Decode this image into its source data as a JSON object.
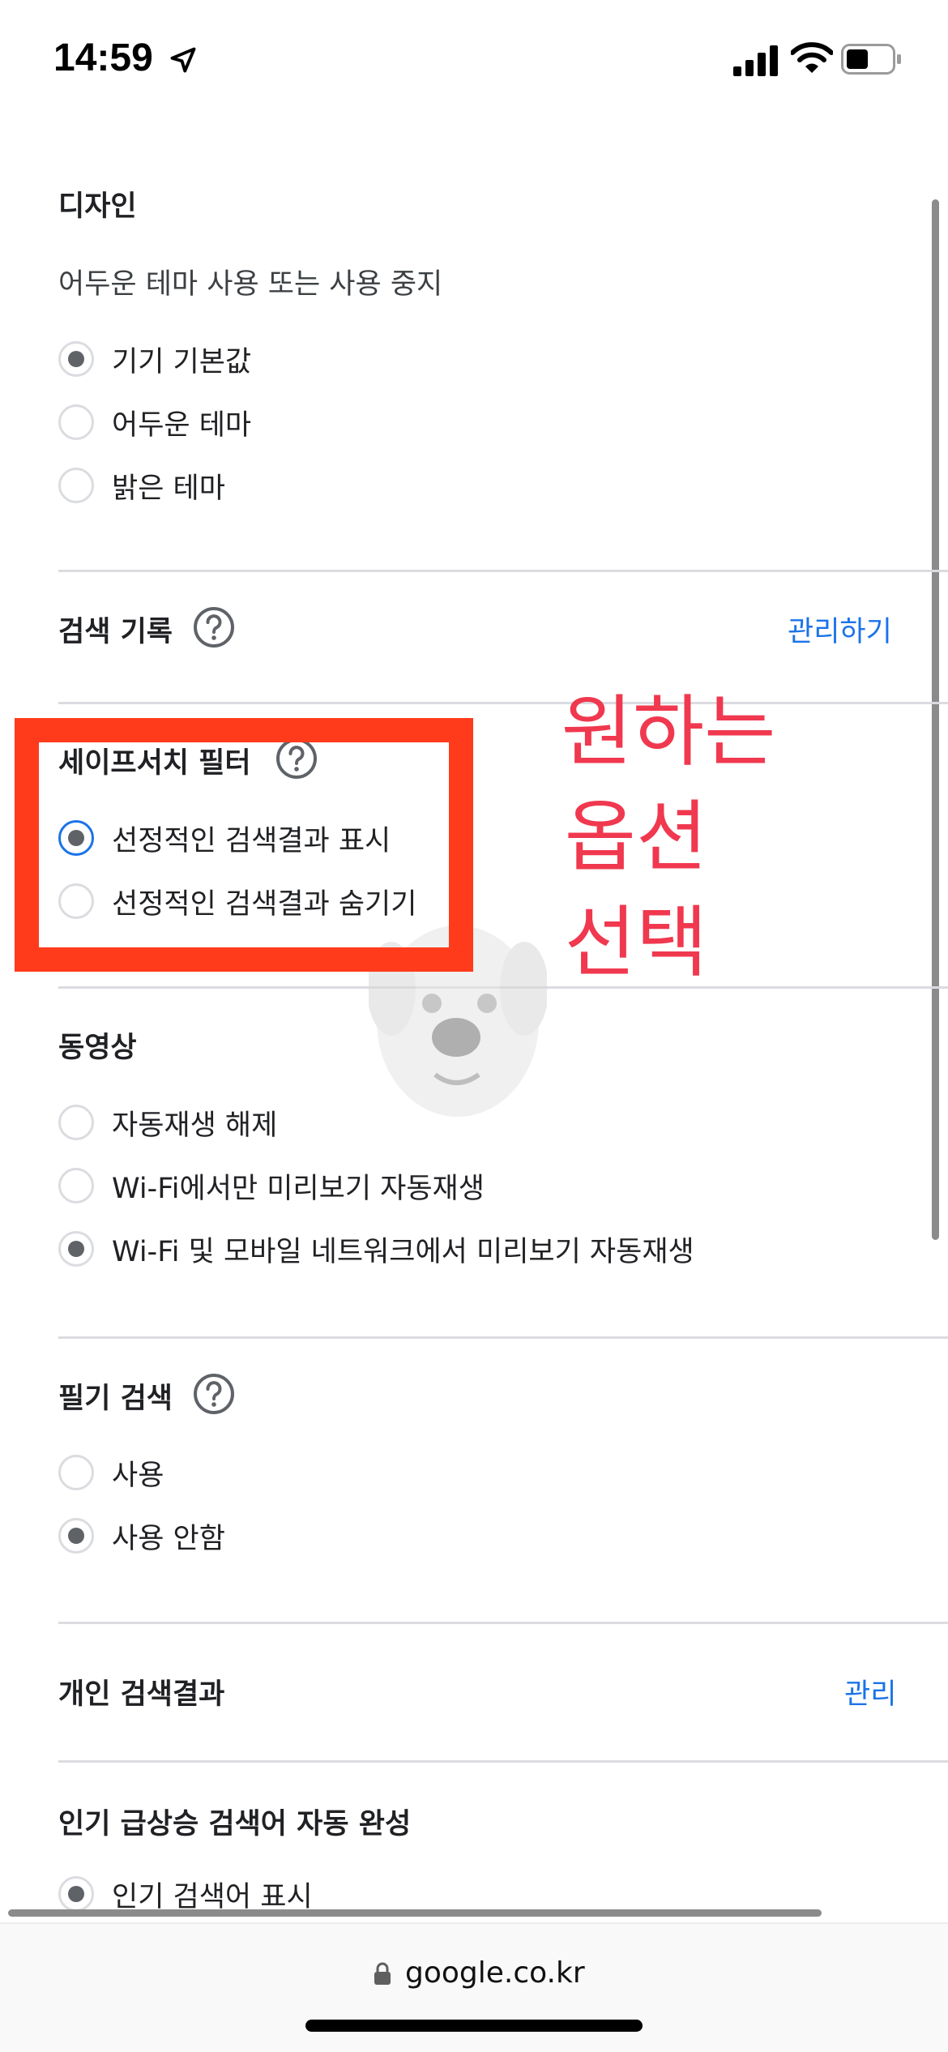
{
  "status_bar": {
    "time": "14:59"
  },
  "design": {
    "title": "디자인",
    "description": "어두운 테마 사용 또는 사용 중지",
    "options": [
      {
        "label": "기기 기본값",
        "selected": true
      },
      {
        "label": "어두운 테마",
        "selected": false
      },
      {
        "label": "밝은 테마",
        "selected": false
      }
    ]
  },
  "search_history": {
    "title": "검색 기록",
    "action": "관리하기"
  },
  "safesearch": {
    "title": "세이프서치 필터",
    "options": [
      {
        "label": "선정적인 검색결과 표시",
        "selected": true
      },
      {
        "label": "선정적인 검색결과 숨기기",
        "selected": false
      }
    ]
  },
  "annotation": {
    "line1": "원하는",
    "line2": "옵션",
    "line3": "선택"
  },
  "video": {
    "title": "동영상",
    "options": [
      {
        "label": "자동재생 해제",
        "selected": false
      },
      {
        "label": "Wi-Fi에서만 미리보기 자동재생",
        "selected": false
      },
      {
        "label": "Wi-Fi 및 모바일 네트워크에서 미리보기 자동재생",
        "selected": true
      }
    ]
  },
  "handwriting": {
    "title": "필기 검색",
    "options": [
      {
        "label": "사용",
        "selected": false
      },
      {
        "label": "사용 안함",
        "selected": true
      }
    ]
  },
  "personal_results": {
    "title": "개인 검색결과",
    "action": "관리"
  },
  "trending": {
    "title": "인기 급상승 검색어 자동 완성",
    "options": [
      {
        "label": "인기 검색어 표시",
        "selected": true
      }
    ]
  },
  "url_bar": {
    "domain": "google.co.kr"
  },
  "colors": {
    "accent": "#1a73e8",
    "annotation_red": "#f0384f",
    "highlight_orange": "#ff3b1c"
  }
}
